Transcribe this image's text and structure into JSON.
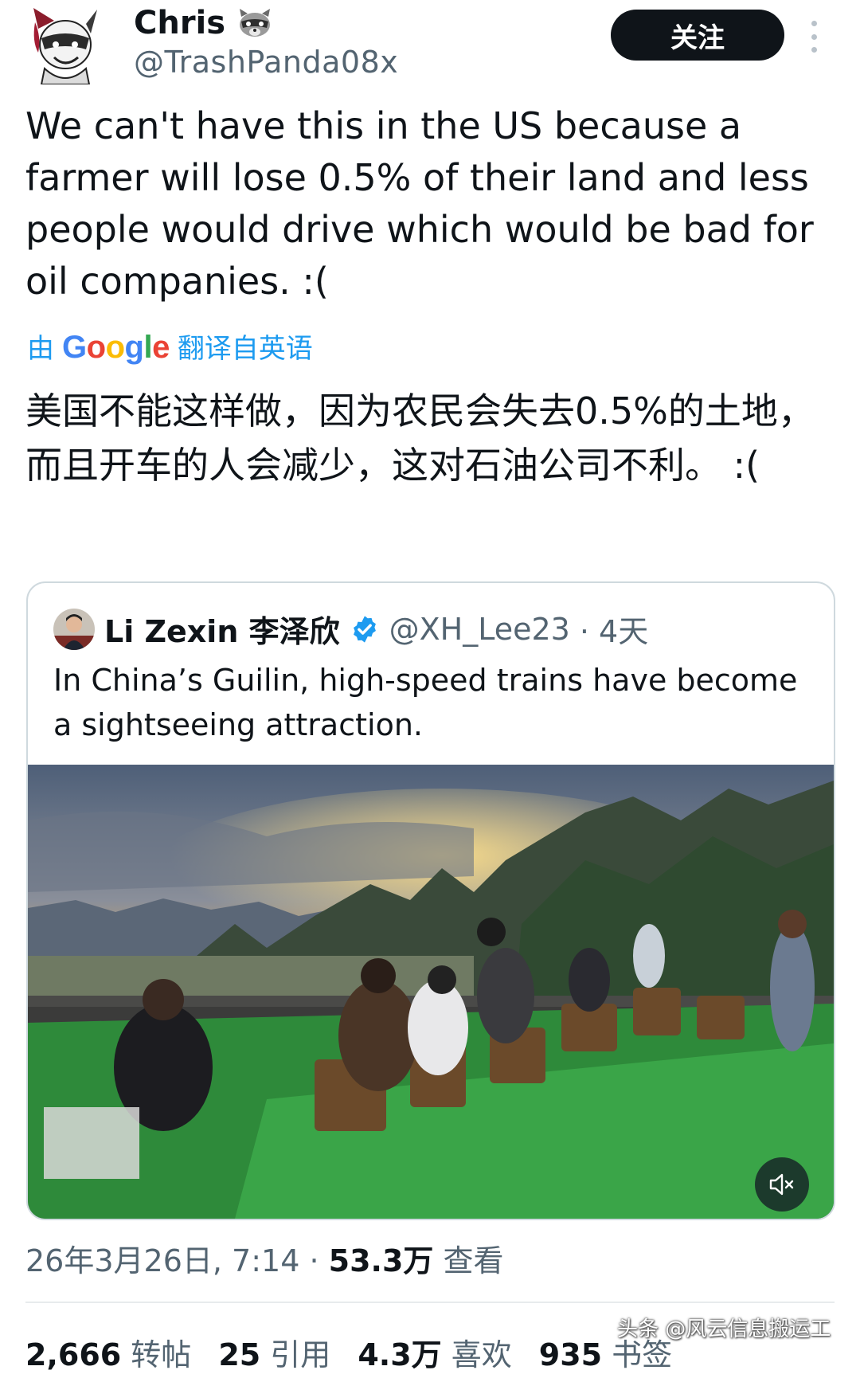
{
  "author": {
    "name": "Chris",
    "name_emoji": "raccoon-icon",
    "handle": "@TrashPanda08x"
  },
  "follow_button_label": "关注",
  "tweet_text": "We can't have this in the US because a farmer will lose 0.5% of their land and less people would drive which would be bad for oil companies. :(",
  "translation": {
    "prefix": "由",
    "provider": "Google",
    "suffix": "翻译自英语",
    "text": "美国不能这样做，因为农民会失去0.5%的土地，而且开车的人会减少，这对石油公司不利。 :("
  },
  "quoted_tweet": {
    "name": "Li Zexin 李泽欣",
    "handle": "@XH_Lee23",
    "time": "· 4天",
    "text": "In China’s Guilin, high-speed trains have become a sightseeing attraction."
  },
  "meta": {
    "timestamp": "26年3月26日, 7:14 ·",
    "views_count": "53.3万",
    "views_label": "查看"
  },
  "stats": [
    {
      "count": "2,666",
      "label": "转帖"
    },
    {
      "count": "25",
      "label": "引用"
    },
    {
      "count": "4.3万",
      "label": "喜欢"
    },
    {
      "count": "935",
      "label": "书签"
    }
  ],
  "watermark": "头条 @风云信息搬运工",
  "colors": {
    "text": "#0f1419",
    "secondary": "#536471",
    "link": "#1d9bf0",
    "border": "#cfd9de",
    "button": "#0f1419"
  }
}
